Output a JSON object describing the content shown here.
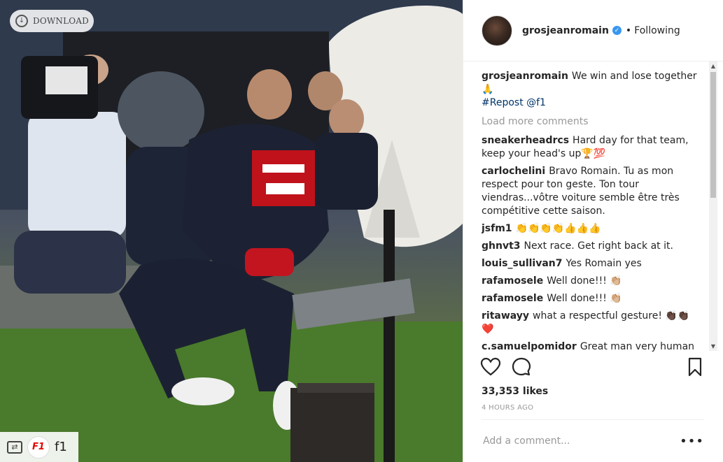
{
  "photo": {
    "download_label": "DOWNLOAD",
    "repost_user": "f1",
    "f1_logo_text": "F1"
  },
  "post": {
    "username": "grosjeanromain",
    "follow_status": "Following",
    "separator": "•",
    "caption": "We win and lose together 🙏",
    "hashtag": "#Repost @f1",
    "load_more": "Load more comments",
    "likes": "33,353 likes",
    "time_ago": "4 HOURS AGO",
    "comment_placeholder": "Add a comment...",
    "more_options": "•••"
  },
  "comments": [
    {
      "user": "sneakerheadrcs",
      "text": "Hard day for that team, keep your head's up🏆💯"
    },
    {
      "user": "carlochelini",
      "text": "Bravo Romain. Tu as mon respect pour ton geste. Ton tour viendras...vôtre voiture semble être très compétitive cette saison."
    },
    {
      "user": "jsfm1",
      "text": "👏👏👏👏👍👍👍"
    },
    {
      "user": "ghnvt3",
      "text": "Next race. Get right back at it."
    },
    {
      "user": "louis_sullivan7",
      "text": "Yes Romain yes"
    },
    {
      "user": "rafamosele",
      "text": "Well done!!! 👏🏼"
    },
    {
      "user": "rafamosele",
      "text": "Well done!!! 👏🏼"
    },
    {
      "user": "ritawayy",
      "text": "what a respectful gesture! 👏🏿👏🏿 ❤️"
    },
    {
      "user": "c.samuelpomidor",
      "text": "Great man very human"
    }
  ],
  "colors": {
    "link": "#003569",
    "verified": "#3897f0",
    "muted": "#999999"
  }
}
